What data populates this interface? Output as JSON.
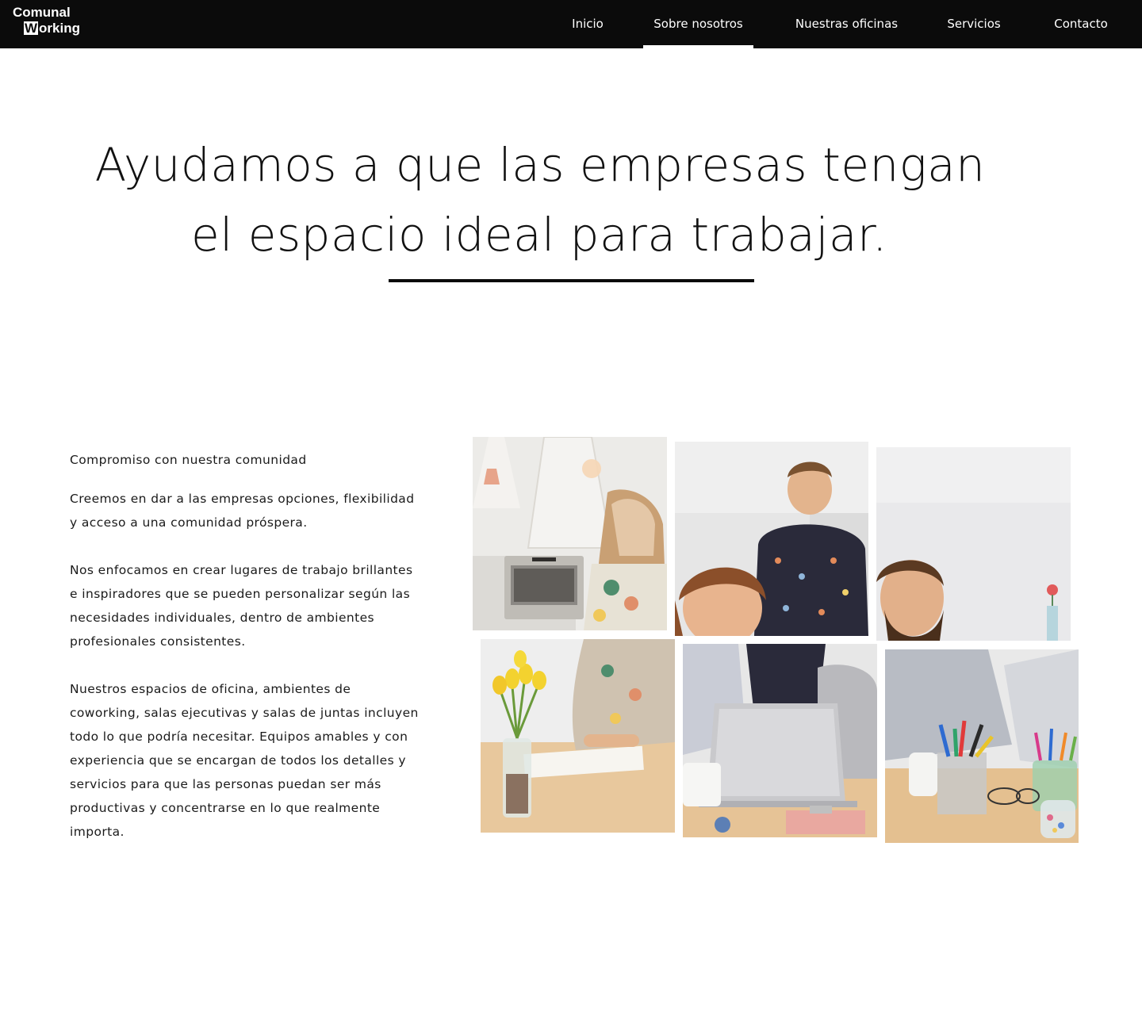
{
  "brand": {
    "line1": "Comunal",
    "line2_letter": "W",
    "line2_rest": "orking"
  },
  "nav": {
    "items": [
      {
        "label": "Inicio"
      },
      {
        "label": "Sobre nosotros"
      },
      {
        "label": "Nuestras oficinas"
      },
      {
        "label": "Servicios"
      },
      {
        "label": "Contacto"
      }
    ],
    "active": "Sobre nosotros"
  },
  "hero": {
    "line1": "Ayudamos a que las empresas tengan",
    "line2": "el espacio ideal para trabajar."
  },
  "about": {
    "heading": "Compromiso con nuestra comunidad",
    "paragraphs": [
      "Creemos en dar a las empresas opciones, flexibilidad y acceso a una comunidad próspera.",
      "Nos enfocamos en crear lugares de trabajo brillantes e inspiradores que se pueden personalizar según las necesidades individuales, dentro de ambientes profesionales consistentes.",
      "Nuestros espacios de oficina, ambientes de coworking, salas ejecutivas y salas de juntas incluyen todo lo que podría necesitar. Equipos amables y con experiencia que se encargan de todos los detalles y servicios para que las personas puedan ser más productivas y concentrarse en lo que realmente importa."
    ]
  },
  "colors": {
    "header_bg": "#0b0b0b",
    "text": "#111111",
    "background": "#ffffff"
  },
  "collage": {
    "tiles": [
      {
        "name": "photo-kitchen-lamps"
      },
      {
        "name": "photo-man-standing"
      },
      {
        "name": "photo-bearded-man"
      },
      {
        "name": "photo-tulips-desk"
      },
      {
        "name": "photo-laptop-team"
      },
      {
        "name": "photo-pens-cups"
      }
    ]
  }
}
